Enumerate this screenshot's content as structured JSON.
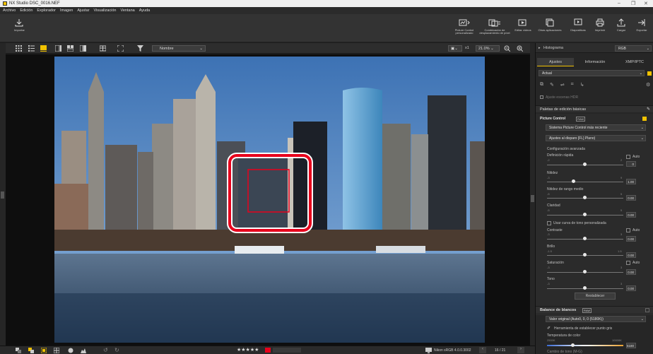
{
  "window": {
    "title": "NX Studio   DSC_0016.NEF",
    "minimize": "–",
    "restore": "❐",
    "close": "✕"
  },
  "menu": [
    "Archivo",
    "Edición",
    "Explorador",
    "Imagen",
    "Ajustar",
    "Visualización",
    "Ventana",
    "Ayuda"
  ],
  "toolbar": {
    "import_label": "Importar",
    "buttons": [
      {
        "label": "Picture Control personalizado",
        "icon": "picture-control-icon"
      },
      {
        "label": "Combinación de desplazamiento de píxel",
        "icon": "pixel-shift-icon"
      },
      {
        "label": "Editar vídeos",
        "icon": "edit-video-icon"
      },
      {
        "label": "Otras aplicaciones",
        "icon": "other-apps-icon"
      },
      {
        "label": "Diapositivas",
        "icon": "slideshow-icon"
      },
      {
        "label": "Imprimir",
        "icon": "print-icon"
      },
      {
        "label": "Cargar",
        "icon": "upload-icon"
      },
      {
        "label": "Exportar",
        "icon": "export-icon"
      }
    ]
  },
  "viewbar": {
    "sort_label": "Nombre",
    "zoom_prefix": "x1",
    "zoom_value": "21.0%"
  },
  "bottom": {
    "stars": "★★★★★",
    "profile": "Nikon sRGB 4.0.0.3002",
    "counter": "16 / 21"
  },
  "panel": {
    "histogram_label": "Histograma",
    "histogram_mode": "RGB",
    "tabs": [
      "Ajustes",
      "Información",
      "XMP/IPTC"
    ],
    "current": "Actual",
    "hdr_option": "Ajuste escenas HDR",
    "basic_palette": "Paletas de edición básicas",
    "picture_control": {
      "title": "Picture Control",
      "badge": "RAW",
      "system": "Sistema Picture Control más reciente",
      "setting": "Ajustes al disparo [FL] Plano)",
      "advanced": "Configuración avanzada",
      "quick_sharp": {
        "label": "Definición rápida",
        "min": "-2",
        "max": "2",
        "auto": "Auto",
        "value": "0"
      },
      "sharpening": {
        "label": "Nitidez",
        "min": "-3",
        "max": "9",
        "value": "1.00"
      },
      "midrange": {
        "label": "Nitidez de rango medio",
        "min": "-5",
        "max": "5",
        "value": "0.00"
      },
      "clarity": {
        "label": "Claridad",
        "min": "-5",
        "max": "5",
        "value": "0.00"
      },
      "custom_curve": "Usar curva de tono personalizada",
      "contrast": {
        "label": "Contraste",
        "min": "-3",
        "max": "3",
        "auto": "Auto",
        "value": "0.00"
      },
      "brightness": {
        "label": "Brillo",
        "min": "-1.5",
        "max": "1.5",
        "value": "0.00"
      },
      "saturation": {
        "label": "Saturación",
        "min": "-3",
        "max": "3",
        "auto": "Auto",
        "value": "0.00"
      },
      "hue": {
        "label": "Tono",
        "min": "-3",
        "max": "3",
        "value": "0.00"
      },
      "reset": "Restablecer"
    },
    "white_balance": {
      "title": "Balance de blancos",
      "badge": "RAW",
      "value": "Valor original (Auto0, 0, 0 (5180K))",
      "tool": "Herramienta de establecer punto gris",
      "temp_label": "Temperatura de color",
      "temp_min": "2500K",
      "temp_max": "10000K",
      "temp_value": "5180",
      "tint_label": "Cambio de tono (M-G)"
    }
  },
  "colors": {
    "accent": "#f2c200",
    "highlight": "#e8001c",
    "panel_bg": "#262626"
  }
}
